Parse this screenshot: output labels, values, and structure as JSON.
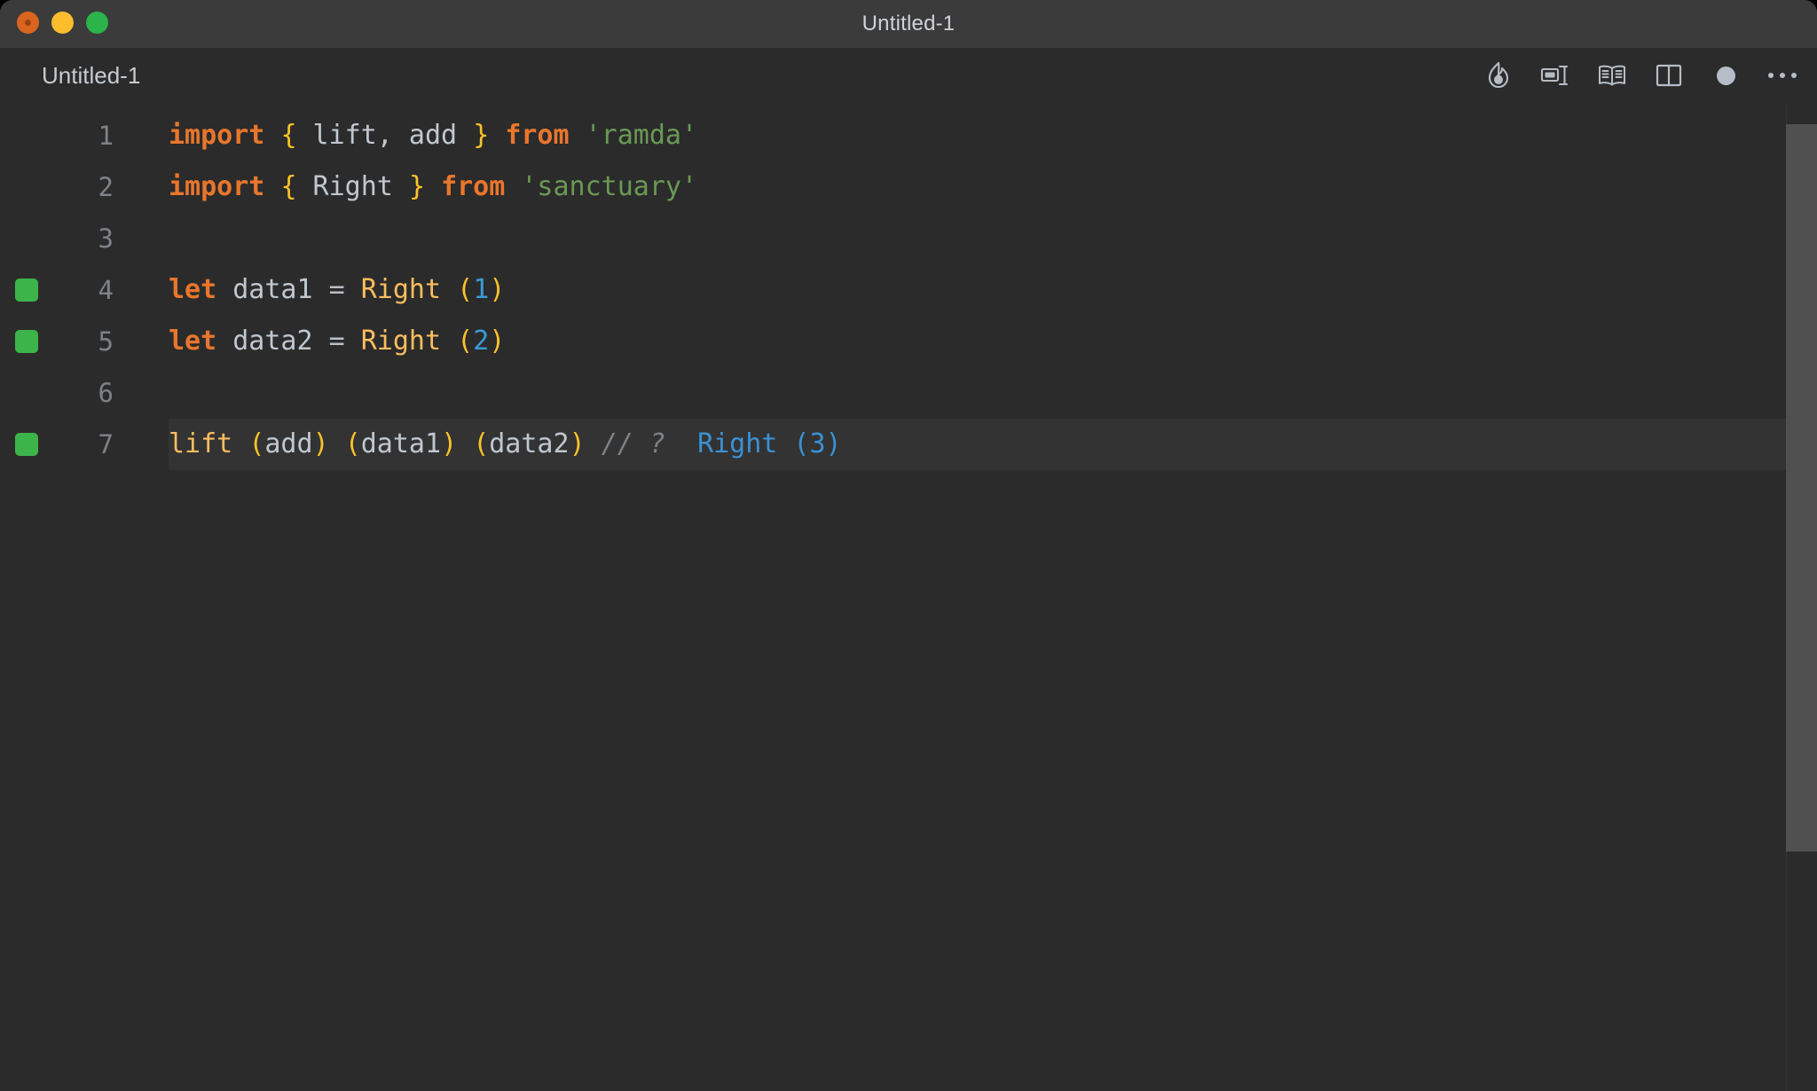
{
  "window": {
    "title": "Untitled-1",
    "traffic_lights": [
      {
        "name": "close",
        "color": "#d9651f"
      },
      {
        "name": "minimize",
        "color": "#fbbd2e"
      },
      {
        "name": "maximize",
        "color": "#2cb34a"
      }
    ]
  },
  "tabstrip": {
    "tab_label": "Untitled-1",
    "actions": [
      {
        "name": "quokka-flame-icon",
        "label": "Quokka"
      },
      {
        "name": "inline-values-icon",
        "label": "Toggle Inline Values"
      },
      {
        "name": "open-preview-icon",
        "label": "Open Preview"
      },
      {
        "name": "split-editor-icon",
        "label": "Split Editor"
      },
      {
        "name": "unsaved-dot-indicator",
        "label": "Unsaved changes"
      },
      {
        "name": "more-actions-icon",
        "label": "More Actions..."
      }
    ]
  },
  "editor": {
    "language": "javascript",
    "active_line": 7,
    "lines": [
      {
        "number": "1",
        "glyph": false,
        "active": false,
        "tokens": [
          {
            "t": "import",
            "c": "k"
          },
          {
            "t": " ",
            "c": "op"
          },
          {
            "t": "{",
            "c": "br"
          },
          {
            "t": " lift, add ",
            "c": "id"
          },
          {
            "t": "}",
            "c": "br"
          },
          {
            "t": " ",
            "c": "op"
          },
          {
            "t": "from",
            "c": "k"
          },
          {
            "t": " ",
            "c": "op"
          },
          {
            "t": "'ramda'",
            "c": "str"
          }
        ]
      },
      {
        "number": "2",
        "glyph": false,
        "active": false,
        "tokens": [
          {
            "t": "import",
            "c": "k"
          },
          {
            "t": " ",
            "c": "op"
          },
          {
            "t": "{",
            "c": "br"
          },
          {
            "t": " Right ",
            "c": "id"
          },
          {
            "t": "}",
            "c": "br"
          },
          {
            "t": " ",
            "c": "op"
          },
          {
            "t": "from",
            "c": "k"
          },
          {
            "t": " ",
            "c": "op"
          },
          {
            "t": "'sanctuary'",
            "c": "str"
          }
        ]
      },
      {
        "number": "3",
        "glyph": false,
        "active": false,
        "tokens": []
      },
      {
        "number": "4",
        "glyph": true,
        "active": false,
        "tokens": [
          {
            "t": "let",
            "c": "k"
          },
          {
            "t": " data1 ",
            "c": "id"
          },
          {
            "t": "=",
            "c": "op"
          },
          {
            "t": " ",
            "c": "op"
          },
          {
            "t": "Right",
            "c": "fn"
          },
          {
            "t": " ",
            "c": "op"
          },
          {
            "t": "(",
            "c": "br"
          },
          {
            "t": "1",
            "c": "num"
          },
          {
            "t": ")",
            "c": "br"
          }
        ]
      },
      {
        "number": "5",
        "glyph": true,
        "active": false,
        "tokens": [
          {
            "t": "let",
            "c": "k"
          },
          {
            "t": " data2 ",
            "c": "id"
          },
          {
            "t": "=",
            "c": "op"
          },
          {
            "t": " ",
            "c": "op"
          },
          {
            "t": "Right",
            "c": "fn"
          },
          {
            "t": " ",
            "c": "op"
          },
          {
            "t": "(",
            "c": "br"
          },
          {
            "t": "2",
            "c": "num"
          },
          {
            "t": ")",
            "c": "br"
          }
        ]
      },
      {
        "number": "6",
        "glyph": false,
        "active": false,
        "tokens": []
      },
      {
        "number": "7",
        "glyph": true,
        "active": true,
        "tokens": [
          {
            "t": "lift",
            "c": "fn"
          },
          {
            "t": " ",
            "c": "op"
          },
          {
            "t": "(",
            "c": "br"
          },
          {
            "t": "add",
            "c": "id"
          },
          {
            "t": ")",
            "c": "br"
          },
          {
            "t": " ",
            "c": "op"
          },
          {
            "t": "(",
            "c": "br"
          },
          {
            "t": "data1",
            "c": "id"
          },
          {
            "t": ")",
            "c": "br"
          },
          {
            "t": " ",
            "c": "op"
          },
          {
            "t": "(",
            "c": "br"
          },
          {
            "t": "data2",
            "c": "id"
          },
          {
            "t": ")",
            "c": "br"
          },
          {
            "t": " ",
            "c": "op"
          },
          {
            "t": "// ?",
            "c": "cm"
          },
          {
            "t": "  ",
            "c": "op"
          },
          {
            "t": "Right (3)",
            "c": "hint"
          }
        ]
      }
    ]
  },
  "colors": {
    "background": "#2b2b2b",
    "titlebar": "#3b3b3b",
    "active_line": "#333333",
    "keyword": "#e8762c",
    "bracket": "#fdc229",
    "identifier": "#c0c7cf",
    "string": "#6a9955",
    "function": "#fbbd5e",
    "number": "#3a9bd9",
    "comment": "#7b8288",
    "inline_hint": "#3a92d4",
    "glyph_marker": "#3cb44a",
    "scrollbar": "#505050"
  }
}
